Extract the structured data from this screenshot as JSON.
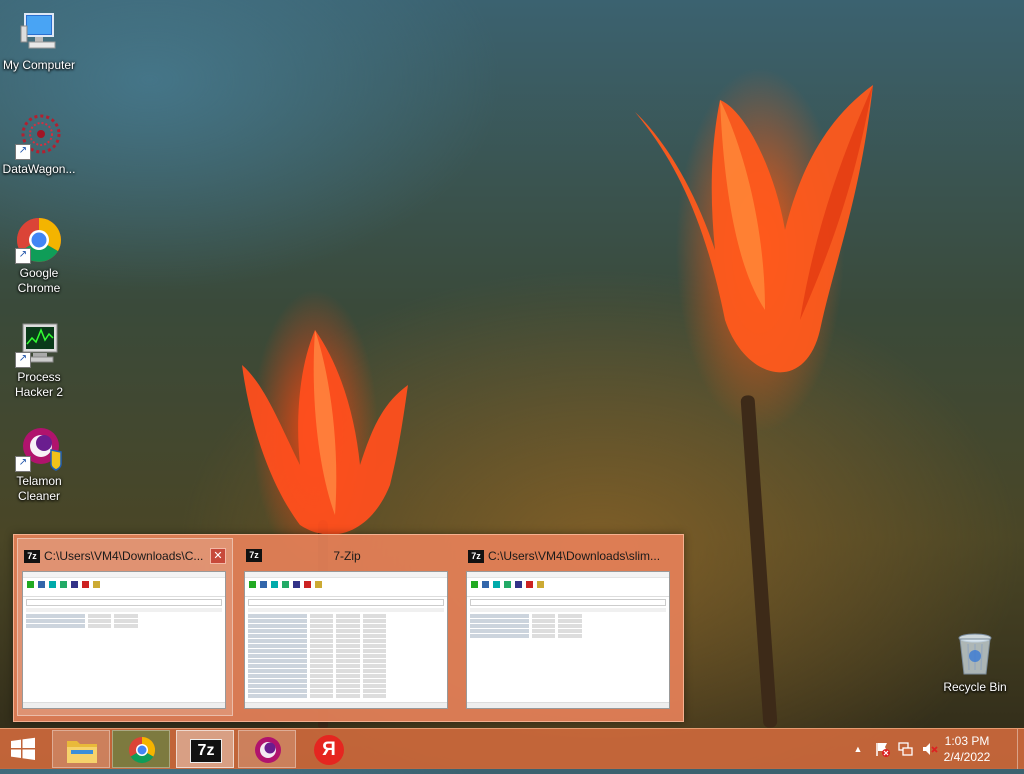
{
  "desktop_icons": [
    {
      "label": "My Computer",
      "icon": "computer-icon"
    },
    {
      "label": "DataWagon...",
      "icon": "datawagon-icon"
    },
    {
      "label": "Google Chrome",
      "icon": "chrome-icon"
    },
    {
      "label": "Process Hacker 2",
      "icon": "process-hacker-icon"
    },
    {
      "label": "Telamon Cleaner",
      "icon": "telamon-icon"
    },
    {
      "label": "Recycle Bin",
      "icon": "recycle-bin-icon"
    }
  ],
  "thumbnails": [
    {
      "title": "C:\\Users\\VM4\\Downloads\\C...",
      "badge": "7z"
    },
    {
      "title": "7-Zip",
      "badge": "7z"
    },
    {
      "title": "C:\\Users\\VM4\\Downloads\\slim...",
      "badge": "7z"
    }
  ],
  "thumb_close_glyph": "✕",
  "taskbar": {
    "items": [
      "file-explorer-icon",
      "chrome-icon",
      "7zip-icon",
      "telamon-icon",
      "yandex-icon"
    ],
    "seven_zip_label": "7z",
    "yandex_glyph": "Я",
    "tray": [
      "show-hidden-icons",
      "action-center-flag-icon",
      "network-icon",
      "volume-muted-icon"
    ],
    "time": "1:03 PM",
    "date": "2/4/2022"
  },
  "colors": {
    "taskbar": "#cd693c",
    "popup": "#e48058",
    "accent": "#c7493a"
  }
}
